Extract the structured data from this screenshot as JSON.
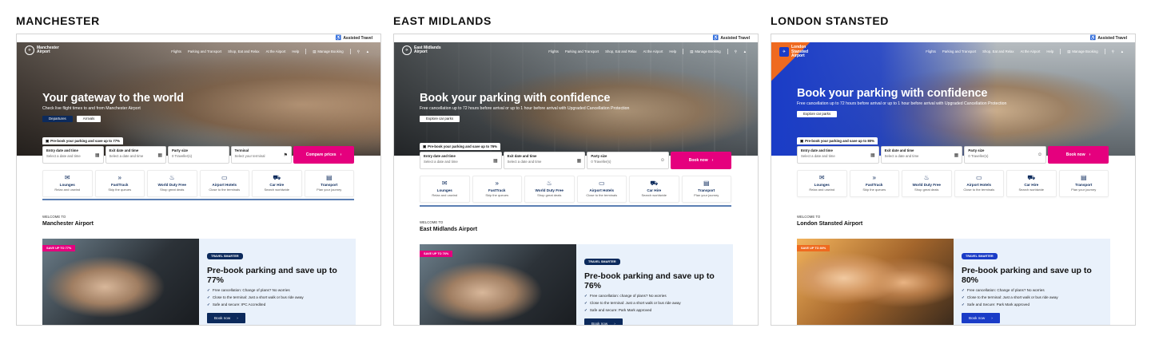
{
  "common": {
    "assisted_travel": "Assisted Travel",
    "nav": [
      "Flights",
      "Parking and Transport",
      "Shop, Eat and Relax",
      "At the Airport",
      "Help"
    ],
    "manage_booking": "Manage Booking",
    "fields": [
      {
        "label": "Entry date and time",
        "placeholder": "Select a date and time"
      },
      {
        "label": "Exit date and time",
        "placeholder": "Select a date and time"
      },
      {
        "label": "Party size",
        "placeholder": "0 Traveller(s)"
      }
    ],
    "services": [
      {
        "name": "Lounges",
        "desc": "Relax and unwind",
        "icon": "lounge-icon"
      },
      {
        "name": "FastTrack",
        "desc": "Skip the queues",
        "icon": "fasttrack-icon"
      },
      {
        "name": "World Duty Free",
        "desc": "Shop great deals",
        "icon": "shopping-icon"
      },
      {
        "name": "Airport Hotels",
        "desc": "Close to the terminals",
        "icon": "hotel-icon"
      },
      {
        "name": "Car Hire",
        "desc": "Search worldwide",
        "icon": "car-icon"
      },
      {
        "name": "Transport",
        "desc": "Plan your journey",
        "icon": "transport-icon"
      }
    ],
    "welcome": "WELCOME TO",
    "tag": "TRAVEL SMARTER",
    "book_now": "Book now",
    "colors": {
      "pink": "#e5007e",
      "navy": "#0c2a5c",
      "panel": "#e9f1fb",
      "stansted_blue": "#1a3cc7",
      "stansted_orange": "#ef6a1f"
    }
  },
  "sites": [
    {
      "title": "MANCHESTER",
      "logo": [
        "Manchester",
        "Airport"
      ],
      "hero_heading": "Your gateway to the world",
      "hero_sub": "Check live flight times to and from Manchester Airport",
      "hero_buttons": [
        "Departures",
        "Arrivals"
      ],
      "promo_tab": "Pre-book your parking and save up to 77%",
      "extra_field": {
        "label": "Terminal",
        "placeholder": "Select your terminal"
      },
      "search_button": "Compare prices",
      "airport_name": "Manchester Airport",
      "badge": "SAVE UP TO 77%",
      "promo_title": "Pre-book parking and save up to 77%",
      "benefits": [
        "Free cancellation: Change of plans? No worries",
        "Close to the terminal: Just a short walk or bus ride away",
        "Safe and secure: IPC Accredited"
      ]
    },
    {
      "title": "EAST MIDLANDS",
      "logo": [
        "East Midlands",
        "Airport"
      ],
      "hero_heading": "Book your parking with confidence",
      "hero_sub": "Free cancellation up to 72 hours before arrival or up to 1 hour before arrival with Upgraded Cancellation Protection",
      "hero_buttons": [
        "Explore car parks"
      ],
      "promo_tab": "Pre-book your parking and save up to 76%",
      "search_button": "Book now",
      "airport_name": "East Midlands Airport",
      "badge": "SAVE UP TO 76%",
      "promo_title": "Pre-book parking and save up to 76%",
      "benefits": [
        "Free cancellation: change of plans? No worries",
        "Close to the terminal: Just a short walk or bus ride away",
        "Safe and secure: Park Mark approved"
      ]
    },
    {
      "title": "LONDON STANSTED",
      "logo": [
        "London",
        "Stansted",
        "Airport"
      ],
      "hero_heading": "Book your parking with confidence",
      "hero_sub": "Free cancellation up to 72 hours before arrival or up to 1 hour before arrival with Upgraded Cancellation Protection",
      "hero_buttons": [
        "Explore car parks"
      ],
      "promo_tab": "Pre-book your parking and save up to 80%",
      "search_button": "Book now",
      "airport_name": "London Stansted Airport",
      "badge": "SAVE UP TO 80%",
      "promo_title": "Pre-book parking and save up to 80%",
      "benefits": [
        "Free cancellation: Change of plans? No worries",
        "Close to the terminal: Just a short walk or bus ride away",
        "Safe and Secure: Park Mark approved"
      ]
    }
  ]
}
